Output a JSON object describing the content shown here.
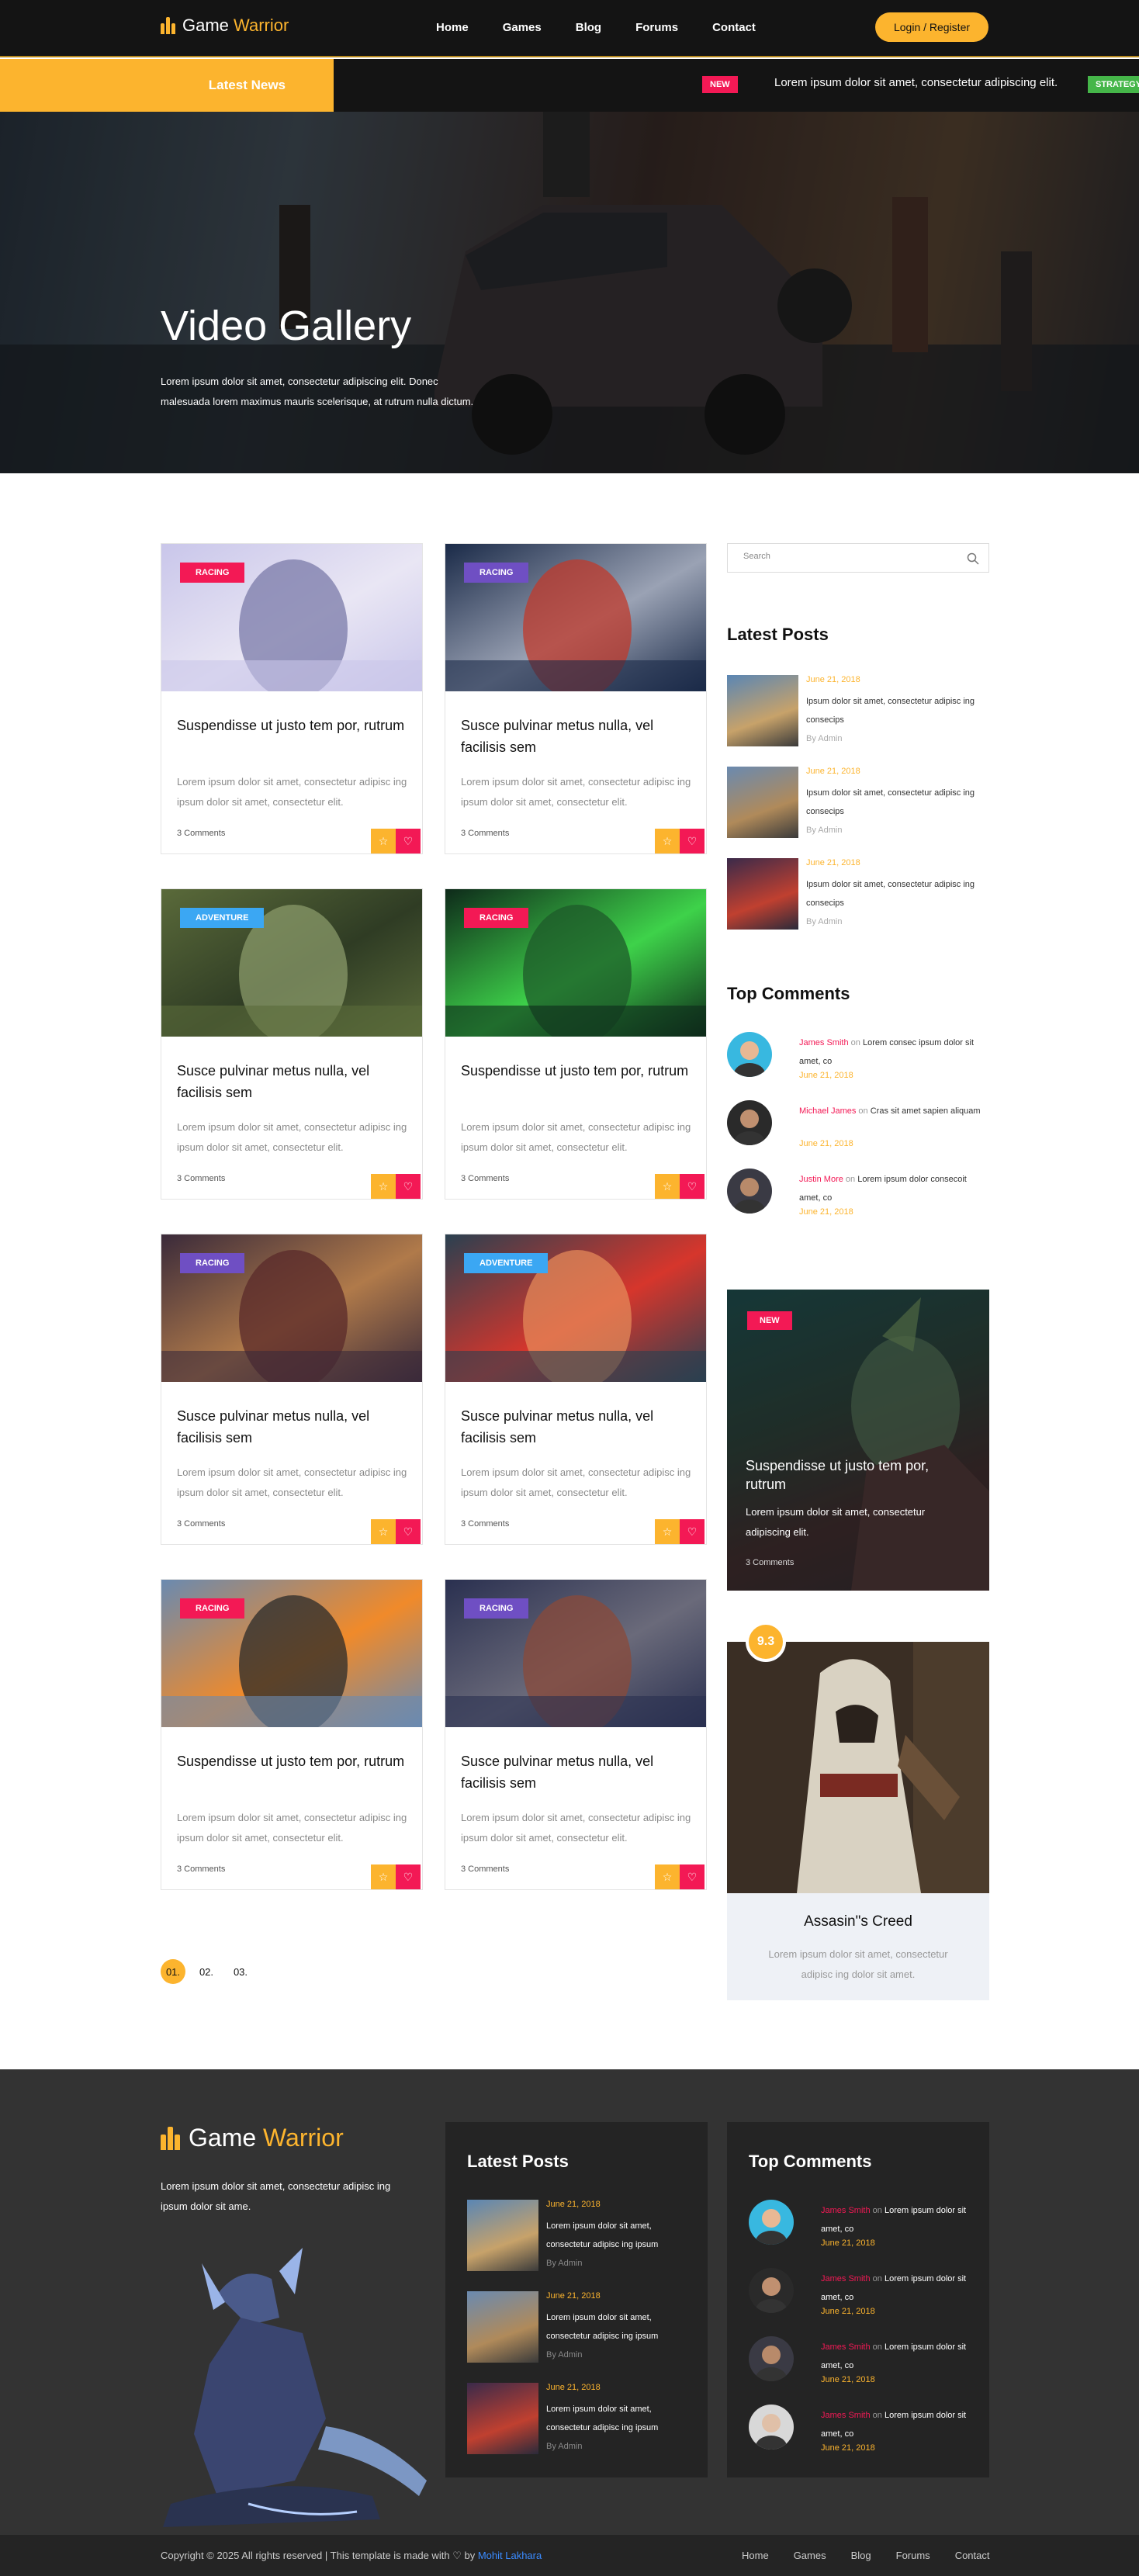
{
  "header": {
    "logo_word1": "Game",
    "logo_word2": "Warrior",
    "nav": [
      "Home",
      "Games",
      "Blog",
      "Forums",
      "Contact"
    ],
    "login_label": "Login / Register"
  },
  "ticker": {
    "label": "Latest News",
    "new_badge": "NEW",
    "headline": "Lorem ipsum dolor sit amet, consectetur adipiscing elit.",
    "next_badge": "STRATEGY"
  },
  "hero": {
    "title": "Video Gallery",
    "text": "Lorem ipsum dolor sit amet, consectetur adipiscing elit. Donec malesuada lorem maximus mauris scelerisque, at rutrum nulla dictum."
  },
  "cards": [
    {
      "tag": "RACING",
      "tag_color": "#f31955",
      "title": "Suspendisse ut justo tem por, rutrum",
      "text": "Lorem ipsum dolor sit amet, consectetur adipisc ing ipsum dolor sit amet, consectetur elit.",
      "comments": "3 Comments"
    },
    {
      "tag": "RACING",
      "tag_color": "#6f4fc3",
      "title": "Susce pulvinar metus nulla, vel facilisis sem",
      "text": "Lorem ipsum dolor sit amet, consectetur adipisc ing ipsum dolor sit amet, consectetur elit.",
      "comments": "3 Comments"
    },
    {
      "tag": "ADVENTURE",
      "tag_color": "#3ba7f3",
      "title": "Susce pulvinar metus nulla, vel facilisis sem",
      "text": "Lorem ipsum dolor sit amet, consectetur adipisc ing ipsum dolor sit amet, consectetur elit.",
      "comments": "3 Comments"
    },
    {
      "tag": "RACING",
      "tag_color": "#f31955",
      "title": "Suspendisse ut justo tem por, rutrum",
      "text": "Lorem ipsum dolor sit amet, consectetur adipisc ing ipsum dolor sit amet, consectetur elit.",
      "comments": "3 Comments"
    },
    {
      "tag": "RACING",
      "tag_color": "#6f4fc3",
      "title": "Susce pulvinar metus nulla, vel facilisis sem",
      "text": "Lorem ipsum dolor sit amet, consectetur adipisc ing ipsum dolor sit amet, consectetur elit.",
      "comments": "3 Comments"
    },
    {
      "tag": "ADVENTURE",
      "tag_color": "#3ba7f3",
      "title": "Susce pulvinar metus nulla, vel facilisis sem",
      "text": "Lorem ipsum dolor sit amet, consectetur adipisc ing ipsum dolor sit amet, consectetur elit.",
      "comments": "3 Comments"
    },
    {
      "tag": "RACING",
      "tag_color": "#f31955",
      "title": "Suspendisse ut justo tem por, rutrum",
      "text": "Lorem ipsum dolor sit amet, consectetur adipisc ing ipsum dolor sit amet, consectetur elit.",
      "comments": "3 Comments"
    },
    {
      "tag": "RACING",
      "tag_color": "#6f4fc3",
      "title": "Susce pulvinar metus nulla, vel facilisis sem",
      "text": "Lorem ipsum dolor sit amet, consectetur adipisc ing ipsum dolor sit amet, consectetur elit.",
      "comments": "3 Comments"
    }
  ],
  "pagination": [
    "01.",
    "02.",
    "03."
  ],
  "sidebar": {
    "search_placeholder": "Search",
    "latest_posts_title": "Latest Posts",
    "latest_posts": [
      {
        "date": "June 21, 2018",
        "text": "Ipsum dolor sit amet, consectetur adipisc ing consecips",
        "by": "By Admin"
      },
      {
        "date": "June 21, 2018",
        "text": "Ipsum dolor sit amet, consectetur adipisc ing consecips",
        "by": "By Admin"
      },
      {
        "date": "June 21, 2018",
        "text": "Ipsum dolor sit amet, consectetur adipisc ing consecips",
        "by": "By Admin"
      }
    ],
    "top_comments_title": "Top Comments",
    "top_comments": [
      {
        "name": "James Smith",
        "on": "on",
        "text": "Lorem consec ipsum dolor sit amet, co",
        "date": "June 21, 2018"
      },
      {
        "name": "Michael James",
        "on": "on",
        "text": "Cras sit amet sapien aliquam",
        "date": "June 21, 2018"
      },
      {
        "name": "Justin More",
        "on": "on",
        "text": "Lorem ipsum dolor consecoit amet, co",
        "date": "June 21, 2018"
      }
    ],
    "promo": {
      "badge": "NEW",
      "title": "Suspendisse ut justo tem por, rutrum",
      "text": "Lorem ipsum dolor sit amet, consectetur adipiscing elit.",
      "comments": "3 Comments"
    },
    "review": {
      "score": "9.3",
      "title": "Assasin\"s Creed",
      "text": "Lorem ipsum dolor sit amet, consectetur adipisc ing dolor sit amet."
    }
  },
  "footer": {
    "logo_word1": "Game",
    "logo_word2": "Warrior",
    "about": "Lorem ipsum dolor sit amet, consectetur adipisc ing ipsum dolor sit ame.",
    "latest_posts_title": "Latest Posts",
    "latest_posts": [
      {
        "date": "June 21, 2018",
        "text": "Lorem ipsum dolor sit amet, consectetur adipisc ing ipsum",
        "by": "By Admin"
      },
      {
        "date": "June 21, 2018",
        "text": "Lorem ipsum dolor sit amet, consectetur adipisc ing ipsum",
        "by": "By Admin"
      },
      {
        "date": "June 21, 2018",
        "text": "Lorem ipsum dolor sit amet, consectetur adipisc ing ipsum",
        "by": "By Admin"
      }
    ],
    "top_comments_title": "Top Comments",
    "top_comments": [
      {
        "name": "James Smith",
        "on": "on",
        "text": "Lorem ipsum dolor sit amet, co",
        "date": "June 21, 2018"
      },
      {
        "name": "James Smith",
        "on": "on",
        "text": "Lorem ipsum dolor sit amet, co",
        "date": "June 21, 2018"
      },
      {
        "name": "James Smith",
        "on": "on",
        "text": "Lorem ipsum dolor sit amet, co",
        "date": "June 21, 2018"
      },
      {
        "name": "James Smith",
        "on": "on",
        "text": "Lorem ipsum dolor sit amet, co",
        "date": "June 21, 2018"
      }
    ]
  },
  "bottom": {
    "copyright_prefix": "Copyright © 2025 All rights reserved | This template is made with",
    "heart": "♡",
    "by": "by",
    "author": "Mohit Lakhara",
    "nav": [
      "Home",
      "Games",
      "Blog",
      "Forums",
      "Contact"
    ]
  },
  "colors": {
    "accent": "#fcb42e",
    "pink": "#f31955",
    "green": "#45b649",
    "dark": "#141414"
  }
}
